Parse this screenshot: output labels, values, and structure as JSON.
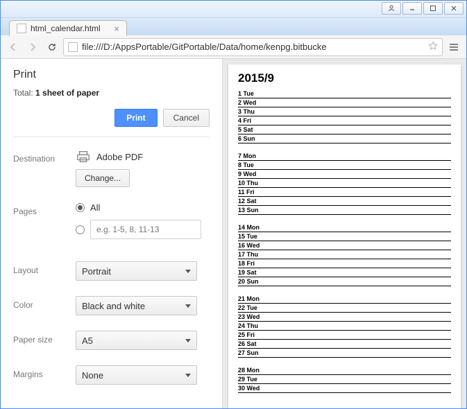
{
  "window": {
    "title": ""
  },
  "tab": {
    "title": "html_calendar.html"
  },
  "url": "file:///D:/AppsPortable/GitPortable/Data/home/kenpg.bitbucke",
  "print": {
    "heading": "Print",
    "total_prefix": "Total: ",
    "total_bold": "1 sheet of paper",
    "print_btn": "Print",
    "cancel_btn": "Cancel",
    "destination_label": "Destination",
    "destination_value": "Adobe PDF",
    "change_btn": "Change...",
    "pages_label": "Pages",
    "pages_all": "All",
    "pages_placeholder": "e.g. 1-5, 8, 11-13",
    "layout_label": "Layout",
    "layout_value": "Portrait",
    "color_label": "Color",
    "color_value": "Black and white",
    "paper_label": "Paper size",
    "paper_value": "A5",
    "margins_label": "Margins",
    "margins_value": "None"
  },
  "preview": {
    "title": "2015/9",
    "weeks": [
      [
        "1 Tue",
        "2 Wed",
        "3 Thu",
        "4 Fri",
        "5 Sat",
        "6 Sun"
      ],
      [
        "7 Mon",
        "8 Tue",
        "9 Wed",
        "10 Thu",
        "11 Fri",
        "12 Sat",
        "13 Sun"
      ],
      [
        "14 Mon",
        "15 Tue",
        "16 Wed",
        "17 Thu",
        "18 Fri",
        "19 Sat",
        "20 Sun"
      ],
      [
        "21 Mon",
        "22 Tue",
        "23 Wed",
        "24 Thu",
        "25 Fri",
        "26 Sat",
        "27 Sun"
      ],
      [
        "28 Mon",
        "29 Tue",
        "30 Wed"
      ]
    ]
  }
}
